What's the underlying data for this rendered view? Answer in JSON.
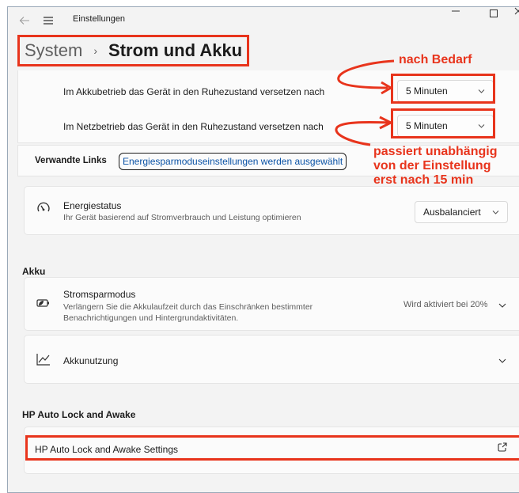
{
  "window": {
    "title": "Einstellungen"
  },
  "breadcrumb": {
    "parent": "System",
    "separator": "›",
    "current": "Strom und Akku"
  },
  "sleep": {
    "battery_label": "Im Akkubetrieb das Gerät in den Ruhezustand versetzen nach",
    "battery_value": "5 Minuten",
    "plugged_label": "Im Netzbetrieb das Gerät in den Ruhezustand versetzen nach",
    "plugged_value": "5 Minuten"
  },
  "related_links": {
    "label": "Verwandte Links",
    "link": "Energiesparmoduseinstellungen werden ausgewählt"
  },
  "power_mode": {
    "title": "Energiestatus",
    "subtitle": "Ihr Gerät basierend auf Stromverbrauch und Leistung optimieren",
    "value": "Ausbalanciert"
  },
  "battery_section": {
    "heading": "Akku",
    "saver": {
      "title": "Stromsparmodus",
      "subtitle_line1": "Verlängern Sie die Akkulaufzeit durch das Einschränken bestimmter",
      "subtitle_line2": "Benachrichtigungen und Hintergrundaktivitäten.",
      "status": "Wird aktiviert bei 20%"
    },
    "usage": {
      "title": "Akkunutzung"
    }
  },
  "hp_section": {
    "heading": "HP Auto Lock and Awake",
    "item": "HP Auto Lock and Awake Settings"
  },
  "annotations": {
    "on_demand": "nach Bedarf",
    "note_line1": "passiert unabhängig",
    "note_line2": "von der Einstellung",
    "note_line3": "erst nach 15 min"
  },
  "colors": {
    "annotation": "#e8341c",
    "link": "#0b53a6",
    "background": "#f3f3f3",
    "card": "#fbfbfb"
  },
  "icons": [
    "back-arrow-icon",
    "hamburger-menu-icon",
    "minimize-icon",
    "maximize-icon",
    "close-icon",
    "gauge-icon",
    "battery-saver-icon",
    "usage-chart-icon",
    "open-external-icon",
    "chevron-down-icon"
  ]
}
